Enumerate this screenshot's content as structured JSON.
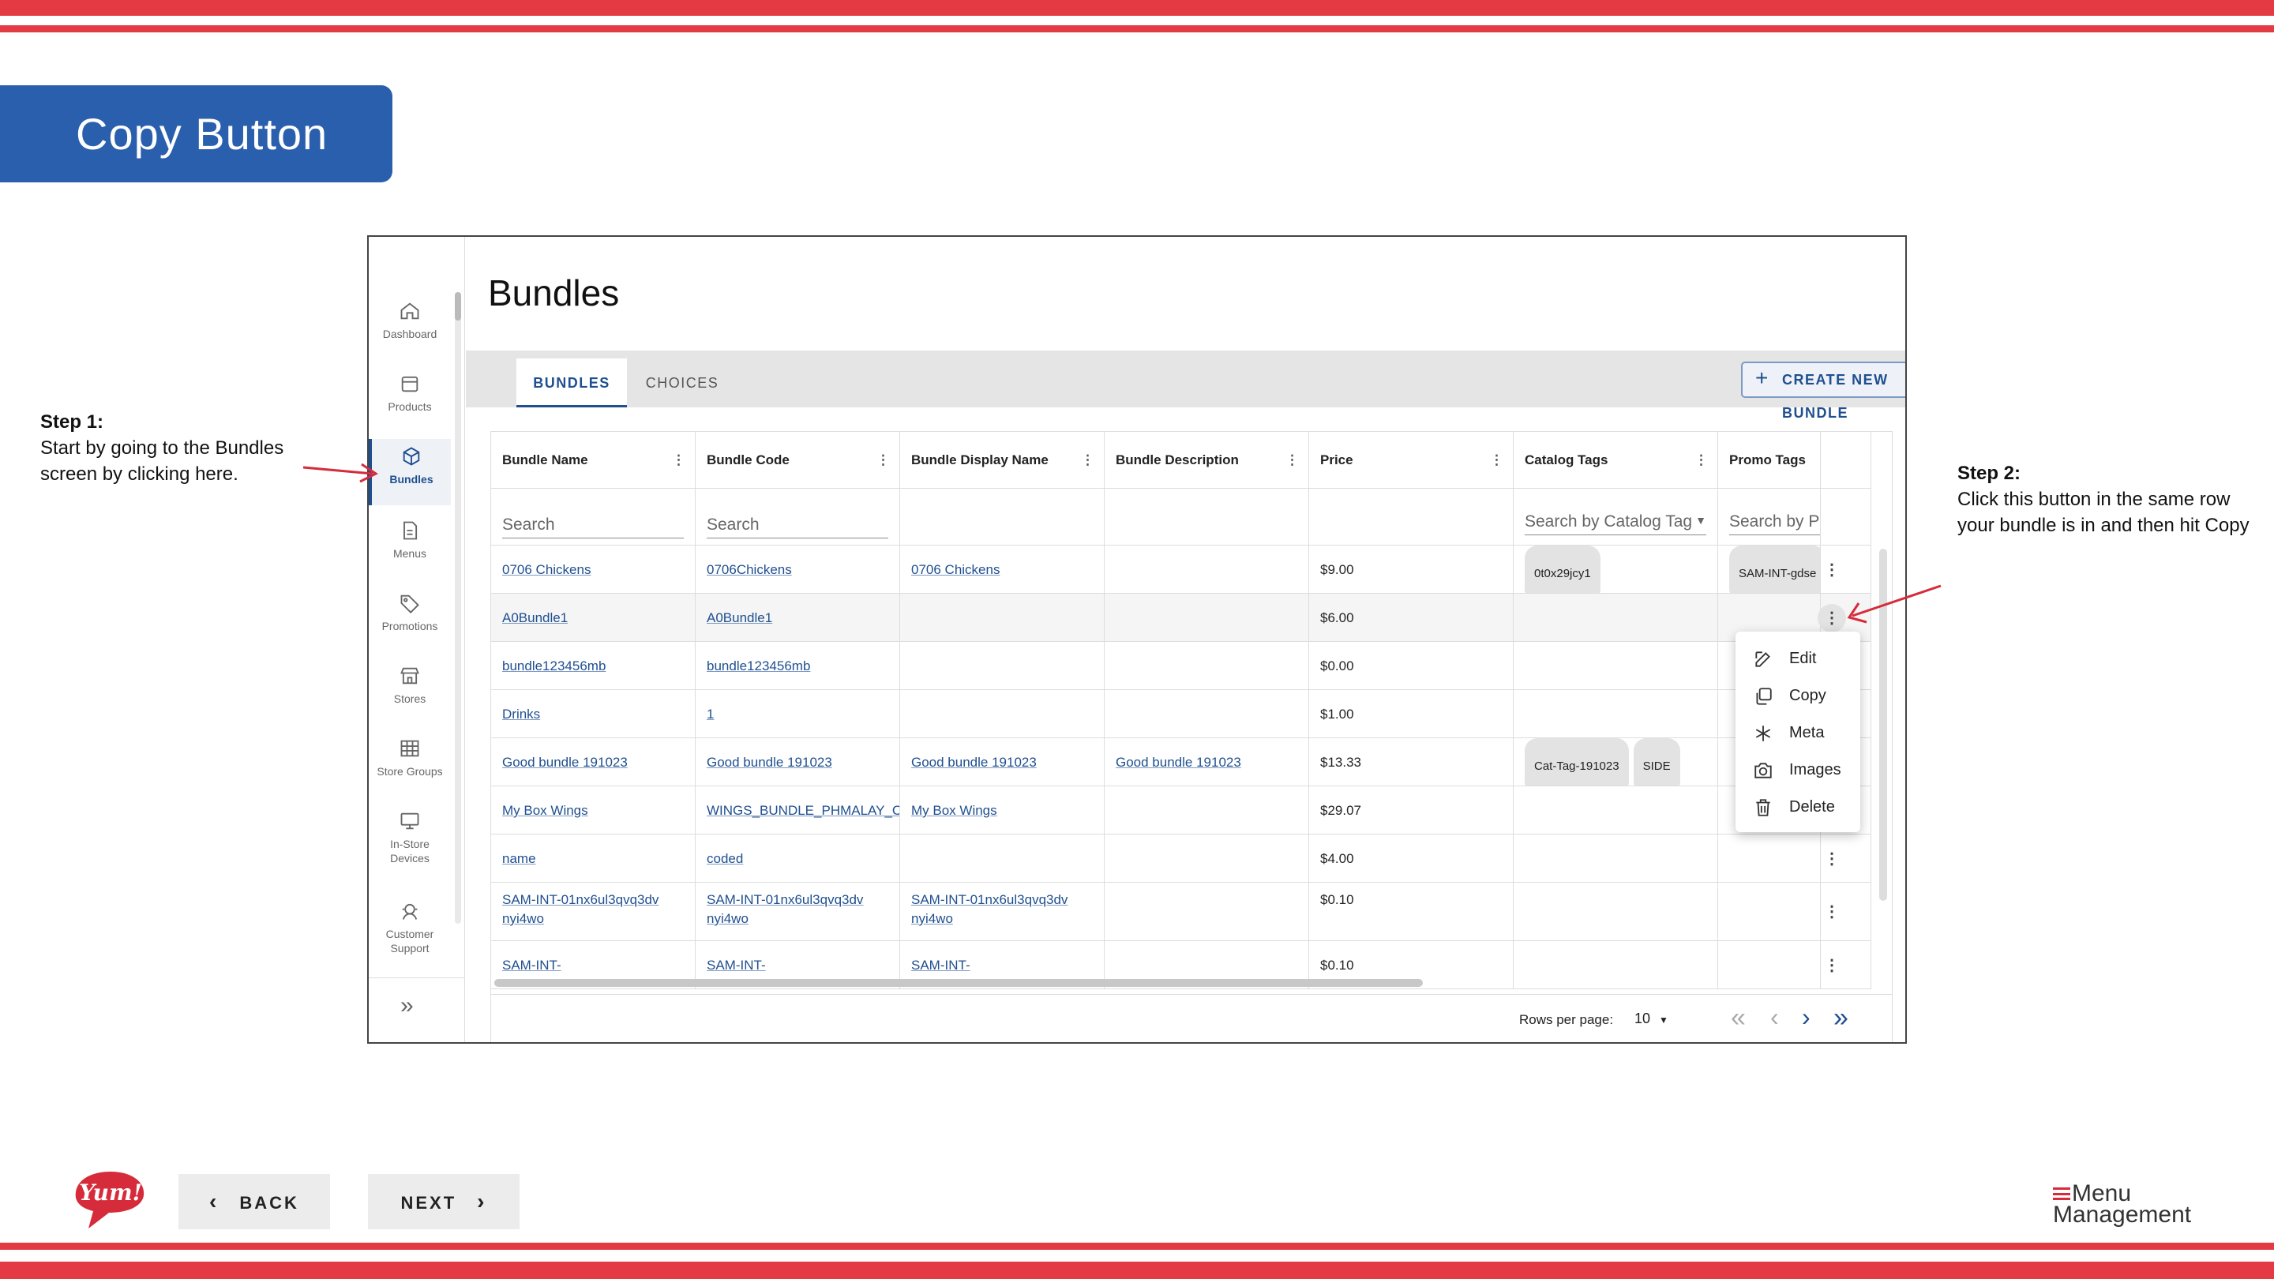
{
  "slide": {
    "title": "Copy  Button",
    "step1": {
      "heading": "Step 1:",
      "text": "Start by going to the Bundles screen by clicking here."
    },
    "step2": {
      "heading": "Step 2:",
      "text": "Click this  button in the same row your bundle is in and then hit Copy"
    },
    "back_label": "BACK",
    "next_label": "NEXT",
    "brand_logo": "Yum!",
    "app_logo_line1": "Menu",
    "app_logo_line2": "Management"
  },
  "colors": {
    "stripe": "#e43a43",
    "title_bg": "#2a5fad",
    "accent": "#1f4f8f"
  },
  "app": {
    "page_title": "Bundles",
    "sidebar": [
      {
        "label": "Dashboard",
        "icon": "home-icon"
      },
      {
        "label": "Products",
        "icon": "box-icon"
      },
      {
        "label": "Bundles",
        "icon": "cube-icon",
        "active": true
      },
      {
        "label": "Menus",
        "icon": "document-icon"
      },
      {
        "label": "Promotions",
        "icon": "tag-icon"
      },
      {
        "label": "Stores",
        "icon": "store-icon"
      },
      {
        "label": "Store Groups",
        "icon": "grid-icon"
      },
      {
        "label": "In-Store Devices",
        "icon": "monitor-icon"
      },
      {
        "label": "Customer Support",
        "icon": "support-icon"
      }
    ],
    "tabs": [
      "BUNDLES",
      "CHOICES"
    ],
    "create_button": "CREATE NEW BUNDLE",
    "columns": [
      "Bundle Name",
      "Bundle Code",
      "Bundle Display Name",
      "Bundle Description",
      "Price",
      "Catalog Tags",
      "Promo Tags"
    ],
    "filters": {
      "name": "Search",
      "code": "Search",
      "catalog": "Search by Catalog Tag",
      "promo": "Search by Pr"
    },
    "rows": [
      {
        "name": "0706 Chickens",
        "code": "0706Chickens",
        "display": "0706 Chickens",
        "description": "",
        "price": "$9.00",
        "catalog": [
          "0t0x29jcy1"
        ],
        "promo": [
          "SAM-INT-gdse"
        ]
      },
      {
        "name": "A0Bundle1",
        "code": "A0Bundle1",
        "display": "",
        "description": "",
        "price": "$6.00",
        "catalog": [],
        "promo": []
      },
      {
        "name": "bundle123456mb",
        "code": "bundle123456mb",
        "display": "",
        "description": "",
        "price": "$0.00",
        "catalog": [],
        "promo": []
      },
      {
        "name": "Drinks",
        "code": "1",
        "display": "",
        "description": "",
        "price": "$1.00",
        "catalog": [],
        "promo": []
      },
      {
        "name": "Good bundle 191023",
        "code": "Good bundle 191023",
        "display": "Good bundle 191023",
        "description": "Good bundle 191023",
        "price": "$13.33",
        "catalog": [
          "Cat-Tag-191023",
          "SIDE"
        ],
        "promo": []
      },
      {
        "name": "My Box Wings",
        "code": "WINGS_BUNDLE_PHMALAY_C",
        "display": "My Box Wings",
        "description": "",
        "price": "$29.07",
        "catalog": [],
        "promo": []
      },
      {
        "name": "name",
        "code": "coded",
        "display": "",
        "description": "",
        "price": "$4.00",
        "catalog": [],
        "promo": []
      },
      {
        "name": "SAM-INT-01nx6ul3qvq3dvnyi4wo",
        "code": "SAM-INT-01nx6ul3qvq3dvnyi4wo",
        "display": "SAM-INT-01nx6ul3qvq3dvnyi4wo",
        "description": "",
        "price": "$0.10",
        "catalog": [],
        "promo": []
      },
      {
        "name": "SAM-INT-",
        "code": "SAM-INT-",
        "display": "SAM-INT-",
        "description": "",
        "price": "$0.10",
        "catalog": [],
        "promo": []
      }
    ],
    "context_menu": [
      {
        "label": "Edit",
        "icon": "edit-icon"
      },
      {
        "label": "Copy",
        "icon": "copy-icon"
      },
      {
        "label": "Meta",
        "icon": "asterisk-icon"
      },
      {
        "label": "Images",
        "icon": "camera-icon"
      },
      {
        "label": "Delete",
        "icon": "trash-icon"
      }
    ],
    "pagination": {
      "rows_per_page_label": "Rows per page:",
      "rows_per_page": "10"
    }
  }
}
